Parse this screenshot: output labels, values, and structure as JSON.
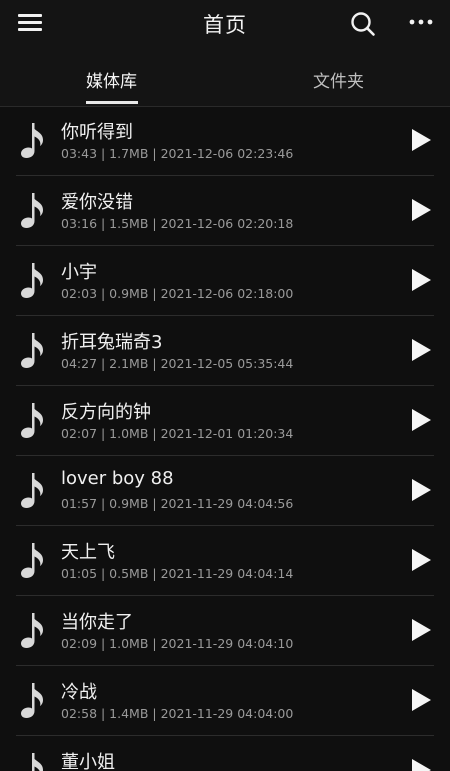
{
  "header": {
    "title": "首页",
    "menu_icon": "hamburger-menu-icon",
    "search_icon": "search-icon",
    "more_icon": "more-dots-icon"
  },
  "tabs": [
    {
      "label": "媒体库",
      "active": true
    },
    {
      "label": "文件夹",
      "active": false
    }
  ],
  "songs": [
    {
      "name": "你听得到",
      "meta": "03:43 | 1.7MB | 2021-12-06 02:23:46"
    },
    {
      "name": "爱你没错",
      "meta": "03:16 | 1.5MB | 2021-12-06 02:20:18"
    },
    {
      "name": "小宇",
      "meta": "02:03 | 0.9MB | 2021-12-06 02:18:00"
    },
    {
      "name": "折耳兔瑞奇3",
      "meta": "04:27 | 2.1MB | 2021-12-05 05:35:44"
    },
    {
      "name": "反方向的钟",
      "meta": "02:07 | 1.0MB | 2021-12-01 01:20:34"
    },
    {
      "name": "lover boy 88",
      "meta": "01:57 | 0.9MB | 2021-11-29 04:04:56"
    },
    {
      "name": "天上飞",
      "meta": "01:05 | 0.5MB | 2021-11-29 04:04:14"
    },
    {
      "name": "当你走了",
      "meta": "02:09 | 1.0MB | 2021-11-29 04:04:10"
    },
    {
      "name": "冷战",
      "meta": "02:58 | 1.4MB | 2021-11-29 04:04:00"
    },
    {
      "name": "董小姐",
      "meta": ""
    }
  ],
  "colors": {
    "background": "#0f0f0f",
    "bar": "#141414",
    "text": "#f0f0f0",
    "meta": "#9a9a9a"
  }
}
